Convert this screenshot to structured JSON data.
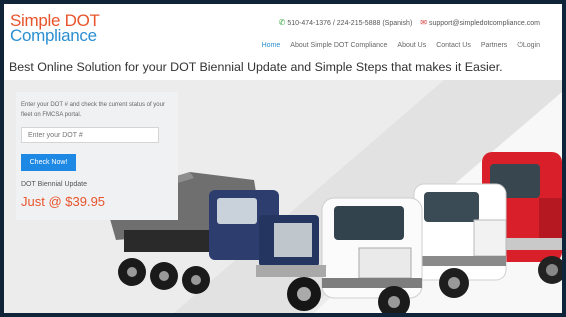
{
  "logo": {
    "line1": "Simple DOT",
    "line2": "Compliance"
  },
  "contact": {
    "phone": "510-474-1376 / 224-215-5888 (Spanish)",
    "email": "support@simpledotcompliance.com",
    "phone_icon": "phone-icon",
    "email_icon": "envelope-icon"
  },
  "nav": {
    "items": [
      "Home",
      "About Simple DOT Compliance",
      "About Us",
      "Contact Us",
      "Partners"
    ],
    "login": "Login",
    "login_icon": "power-icon"
  },
  "headline": "Best Online Solution for your DOT Biennial Update and Simple Steps that makes it Easier.",
  "panel": {
    "intro": "Enter your DOT # and check the current status of your fleet on FMCSA portal.",
    "input_placeholder": "Enter your DOT #",
    "button": "Check Now!",
    "update_label": "DOT Biennial Update",
    "price": "Just @ $39.95"
  },
  "hero_image": "trucks-image",
  "colors": {
    "accent_orange": "#e8542b",
    "accent_blue": "#2b8fd1",
    "button_blue": "#1e88e5",
    "frame": "#0f2438"
  }
}
